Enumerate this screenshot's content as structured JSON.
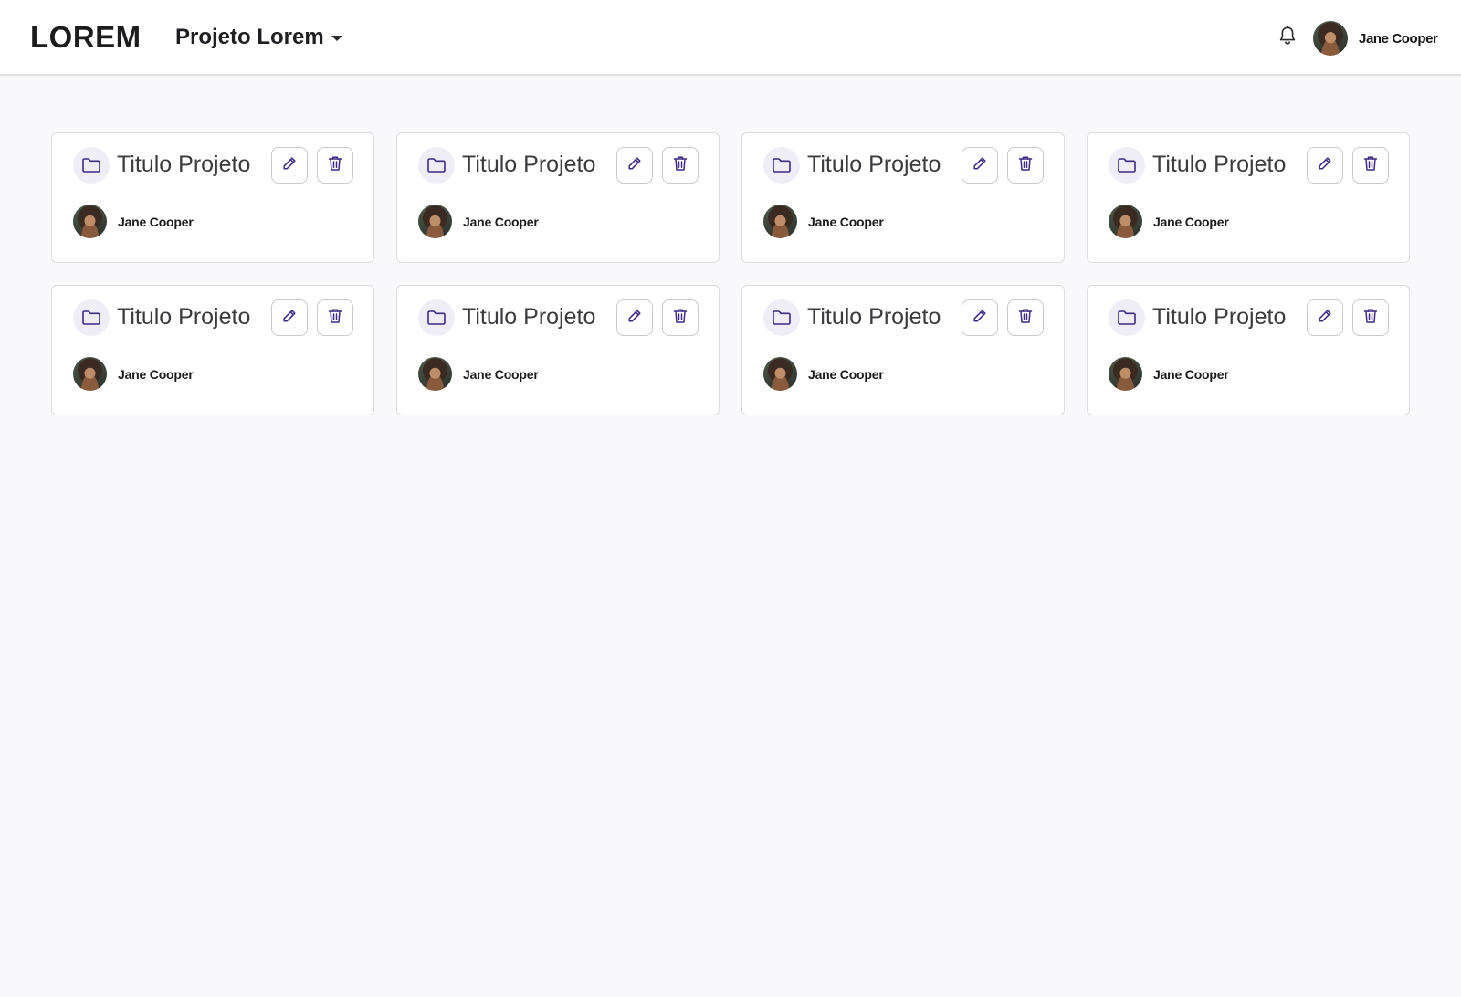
{
  "header": {
    "logo": "LOREM",
    "project_selector": {
      "label": "Projeto Lorem"
    },
    "user": {
      "name": "Jane Cooper"
    }
  },
  "colors": {
    "accent": "#3d2a82",
    "background": "#f9f9fb",
    "card_border": "#dcdce0",
    "folder_bg": "#efedf6"
  },
  "projects": [
    {
      "title": "Titulo Projeto",
      "owner": "Jane Cooper",
      "icon": "folder-icon"
    },
    {
      "title": "Titulo Projeto",
      "owner": "Jane Cooper",
      "icon": "folder-icon"
    },
    {
      "title": "Titulo Projeto",
      "owner": "Jane Cooper",
      "icon": "folder-icon"
    },
    {
      "title": "Titulo Projeto",
      "owner": "Jane Cooper",
      "icon": "folder-icon"
    },
    {
      "title": "Titulo Projeto",
      "owner": "Jane Cooper",
      "icon": "folder-icon"
    },
    {
      "title": "Titulo Projeto",
      "owner": "Jane Cooper",
      "icon": "folder-icon"
    },
    {
      "title": "Titulo Projeto",
      "owner": "Jane Cooper",
      "icon": "folder-icon"
    },
    {
      "title": "Titulo Projeto",
      "owner": "Jane Cooper",
      "icon": "folder-icon"
    }
  ]
}
